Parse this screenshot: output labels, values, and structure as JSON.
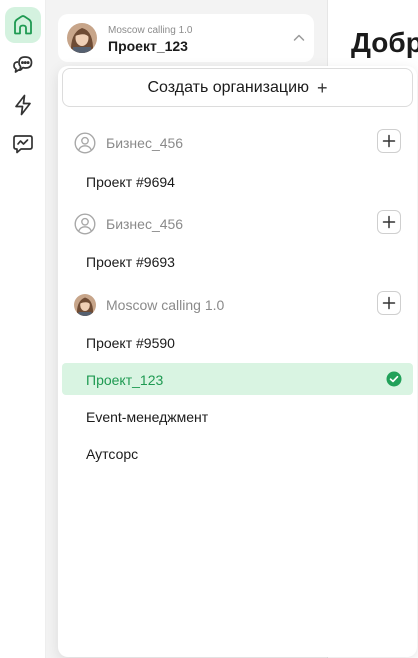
{
  "rail": {
    "items": [
      {
        "icon": "home-icon",
        "active": true
      },
      {
        "icon": "chat-bubbles-icon",
        "active": false
      },
      {
        "icon": "lightning-icon",
        "active": false
      },
      {
        "icon": "analytics-chat-icon",
        "active": false
      }
    ]
  },
  "header": {
    "greeting": "Добр"
  },
  "selector": {
    "organization": "Moscow calling 1.0",
    "project": "Проект_123"
  },
  "dropdown": {
    "create_label": "Создать организацию",
    "create_icon": "+",
    "groups": [
      {
        "name": "Бизнес_456",
        "avatar": "user-placeholder-icon",
        "projects": [
          {
            "name": "Проект #9694",
            "selected": false
          }
        ]
      },
      {
        "name": "Бизнес_456",
        "avatar": "user-placeholder-icon",
        "projects": [
          {
            "name": "Проект #9693",
            "selected": false
          }
        ]
      },
      {
        "name": "Moscow calling 1.0",
        "avatar": "photo-avatar",
        "projects": [
          {
            "name": "Проект #9590",
            "selected": false
          },
          {
            "name": "Проект_123",
            "selected": true
          },
          {
            "name": "Event-менеджмент",
            "selected": false
          },
          {
            "name": "Аутсорс",
            "selected": false
          }
        ]
      }
    ]
  },
  "colors": {
    "accent": "#22a15a",
    "accent_bg": "#d9f4e2",
    "muted_text": "#8a8a8a"
  }
}
